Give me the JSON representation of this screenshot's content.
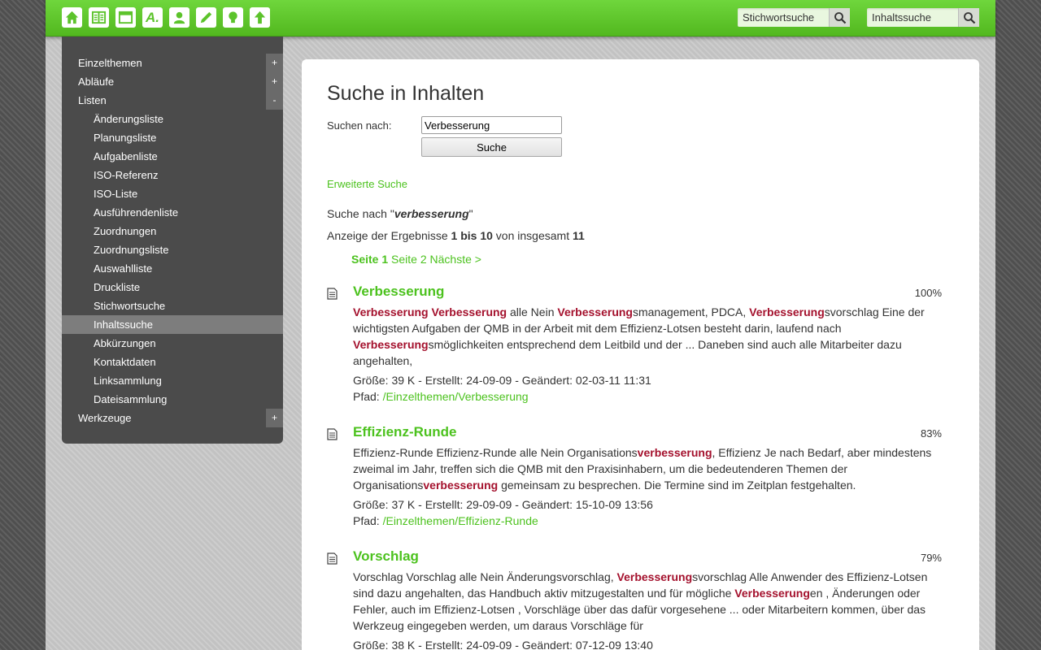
{
  "toolbar": {
    "icons": [
      "home-icon",
      "book-icon",
      "window-icon",
      "abbreviation-icon",
      "user-icon",
      "pencil-icon",
      "lightbulb-icon",
      "upload-arrow-icon"
    ],
    "abbr_glyph": "A.",
    "keyword_search_placeholder": "Stichwortsuche",
    "content_search_placeholder": "Inhaltssuche"
  },
  "sidebar": {
    "items": [
      {
        "label": "Einzelthemen",
        "toggle": "+"
      },
      {
        "label": "Abläufe",
        "toggle": "+"
      },
      {
        "label": "Listen",
        "toggle": "-"
      },
      {
        "label": "Änderungsliste"
      },
      {
        "label": "Planungsliste"
      },
      {
        "label": "Aufgabenliste"
      },
      {
        "label": "ISO-Referenz"
      },
      {
        "label": "ISO-Liste"
      },
      {
        "label": "Ausführendenliste"
      },
      {
        "label": "Zuordnungen"
      },
      {
        "label": "Zuordnungsliste"
      },
      {
        "label": "Auswahlliste"
      },
      {
        "label": "Druckliste"
      },
      {
        "label": "Stichwortsuche"
      },
      {
        "label": "Inhaltssuche"
      },
      {
        "label": "Abkürzungen"
      },
      {
        "label": "Kontaktdaten"
      },
      {
        "label": "Linksammlung"
      },
      {
        "label": "Dateisammlung"
      },
      {
        "label": "Werkzeuge",
        "toggle": "+"
      }
    ]
  },
  "main": {
    "title": "Suche in Inhalten",
    "search_label": "Suchen nach:",
    "search_value": "Verbesserung",
    "search_button": "Suche",
    "advanced_link": "Erweiterte Suche",
    "query_prefix": "Suche nach \"",
    "query_term": "verbesserung",
    "query_suffix": "\"",
    "results_prefix": "Anzeige der Ergebnisse ",
    "results_range": "1 bis 10",
    "results_mid": " von insgesamt ",
    "results_total": "11",
    "pager": {
      "current": "Seite 1",
      "page2": "Seite 2",
      "next": "Nächste >"
    },
    "results": [
      {
        "title": "Verbesserung",
        "score": "100%",
        "size": "Größe: 39 K - Erstellt: 24-09-09 - Geändert: 02-03-11 11:31",
        "path_label": "Pfad: ",
        "path": "/Einzelthemen/Verbesserung",
        "segments": [
          {
            "hl": "Verbesserung"
          },
          {
            "t": " "
          },
          {
            "hl": "Verbesserung"
          },
          {
            "t": " alle Nein "
          },
          {
            "hl": "Verbesserung"
          },
          {
            "t": "smanagement, PDCA, "
          },
          {
            "hl": "Verbesserung"
          },
          {
            "t": "svorschlag Eine der wichtigsten Aufgaben der  QMB in der Arbeit mit dem  Effizienz-Lotsen besteht darin, laufend nach "
          },
          {
            "hl": "Verbesserung"
          },
          {
            "t": "smöglichkeiten entsprechend dem  Leitbild  und der ... Daneben sind auch alle Mitarbeiter dazu angehalten,"
          }
        ]
      },
      {
        "title": "Effizienz-Runde",
        "score": "83%",
        "size": "Größe: 37 K - Erstellt: 29-09-09 - Geändert: 15-10-09 13:56",
        "path_label": "Pfad: ",
        "path": "/Einzelthemen/Effizienz-Runde",
        "segments": [
          {
            "t": "Effizienz-Runde Effizienz-Runde alle Nein Organisations"
          },
          {
            "hl": "verbesserung"
          },
          {
            "t": ", Effizienz Je nach Bedarf, aber mindestens zweimal im Jahr, treffen sich die  QMB mit den Praxisinhabern, um die bedeutenderen Themen der Organisations"
          },
          {
            "hl": "verbesserung"
          },
          {
            "t": " gemeinsam zu besprechen. Die Termine sind im Zeitplan festgehalten."
          }
        ]
      },
      {
        "title": "Vorschlag",
        "score": "79%",
        "size": "Größe: 38 K - Erstellt: 24-09-09 - Geändert: 07-12-09 13:40",
        "segments": [
          {
            "t": "Vorschlag Vorschlag alle Nein Änderungsvorschlag, "
          },
          {
            "hl": "Verbesserung"
          },
          {
            "t": "svorschlag Alle Anwender des  Effizienz-Lotsen sind dazu angehalten, das Handbuch aktiv mitzugestalten und für mögliche  "
          },
          {
            "hl": "Verbesserung"
          },
          {
            "t": "en , Änderungen oder Fehler, auch im  Effizienz-Lotsen , Vorschläge über das dafür vorgesehene ... oder Mitarbeitern kommen, über das Werkzeug eingegeben werden, um daraus Vorschläge für"
          }
        ]
      }
    ]
  }
}
